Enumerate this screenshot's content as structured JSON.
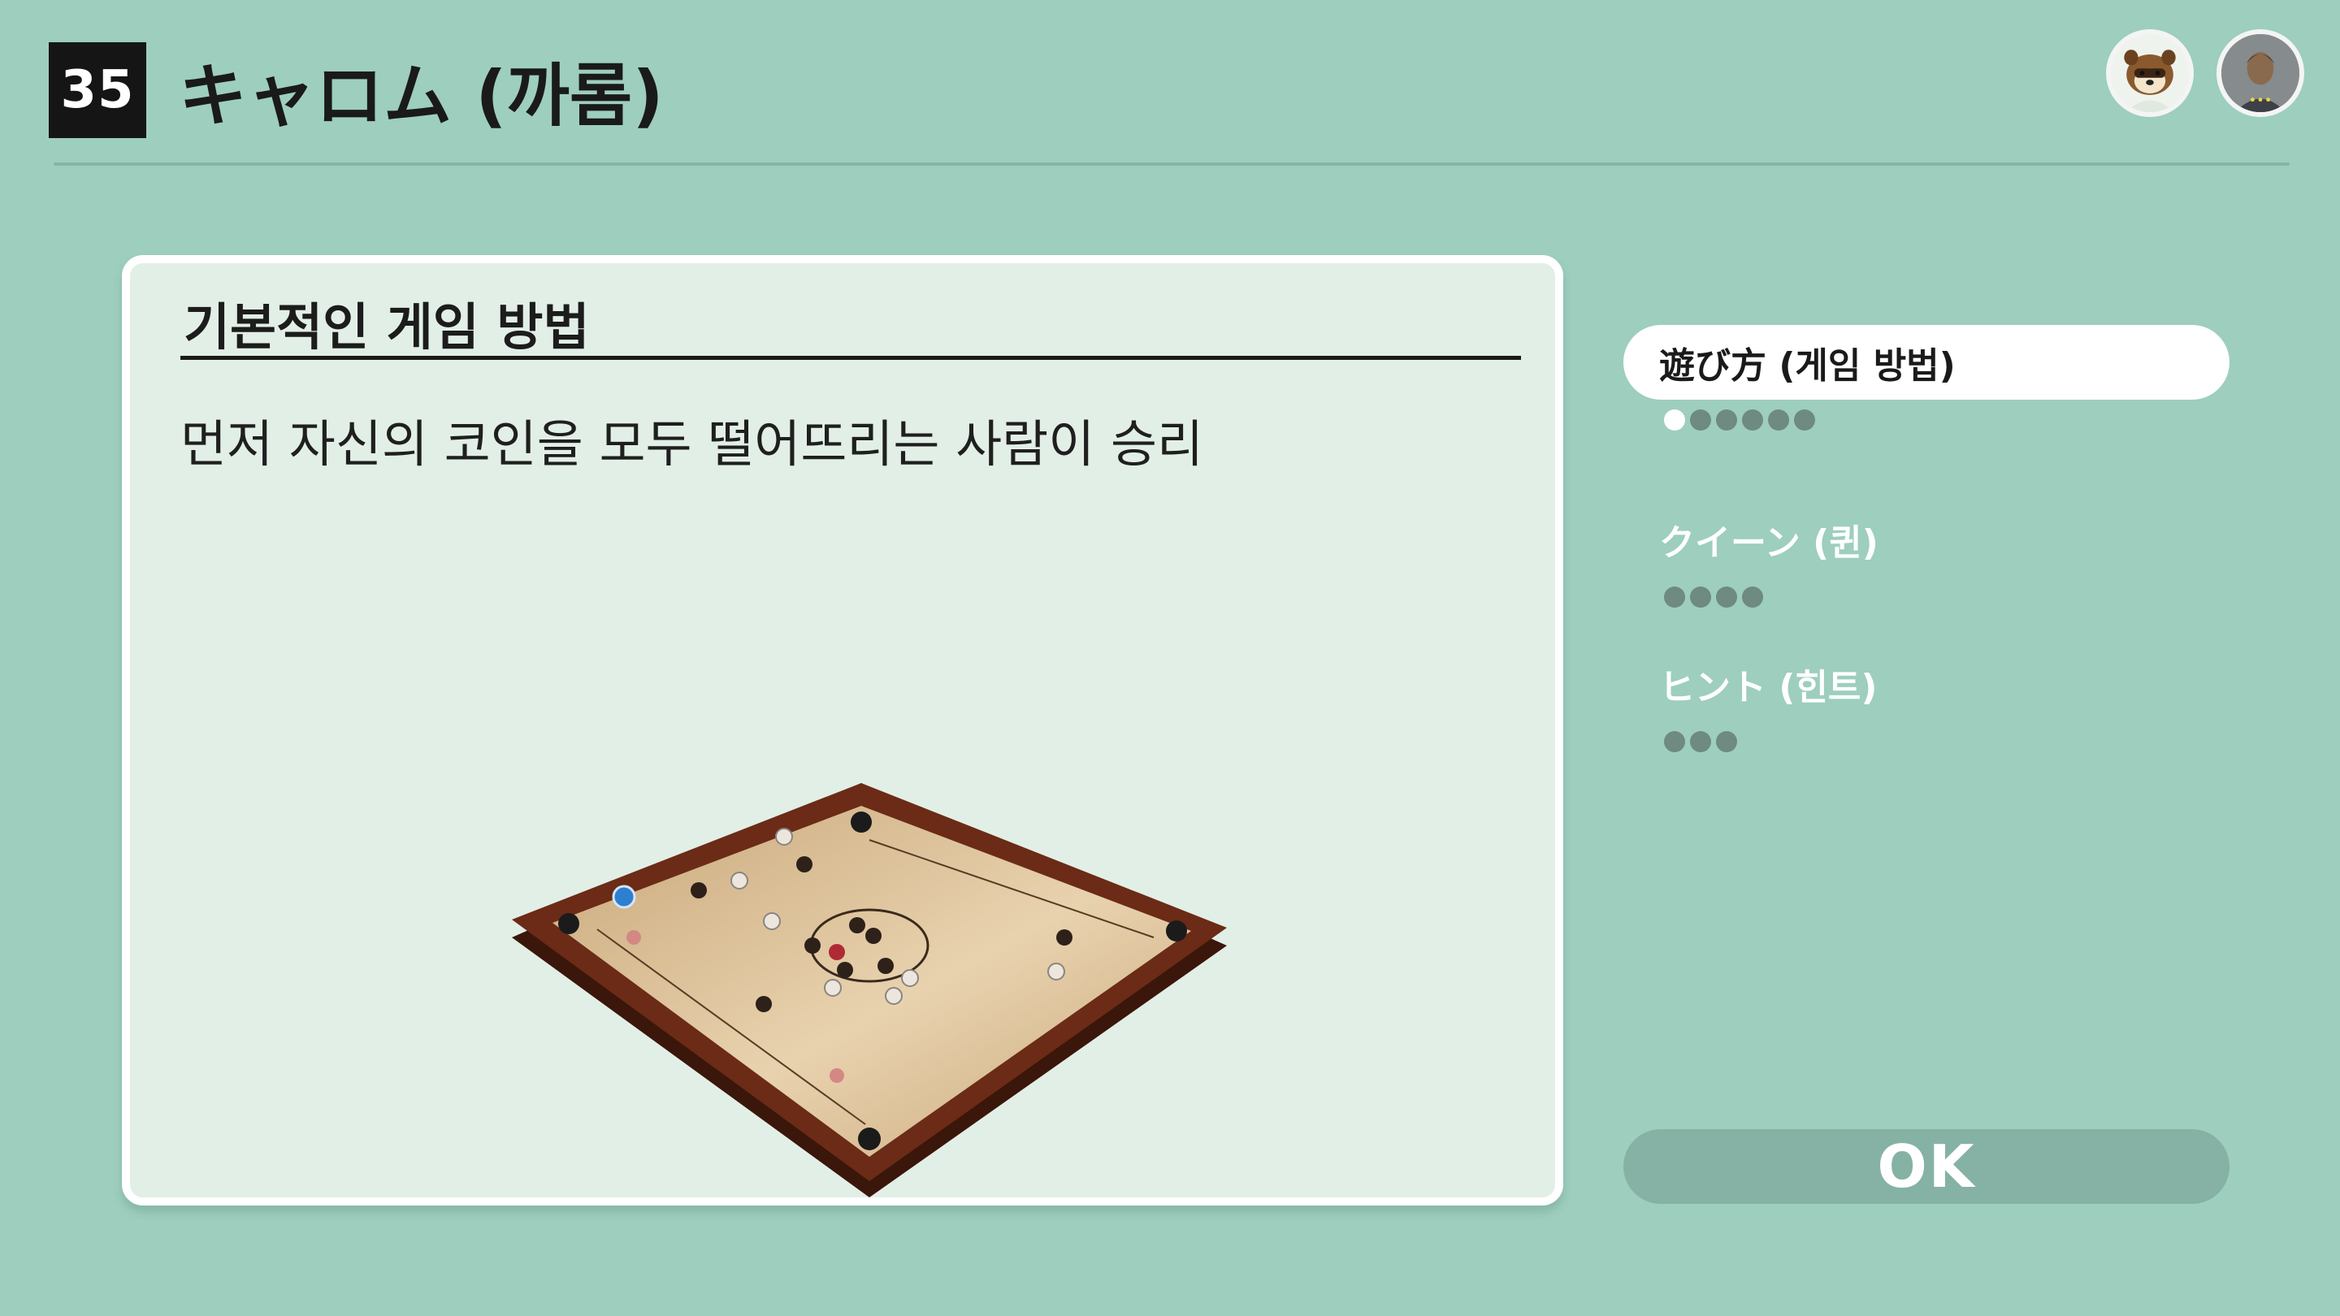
{
  "header": {
    "number": "35",
    "title": "キャロム (까롬)"
  },
  "avatars": [
    {
      "name": "villager-raccoon-avatar"
    },
    {
      "name": "player-avatar"
    }
  ],
  "card": {
    "heading": "기본적인 게임 방법",
    "body": "먼저 자신의 코인을 모두 떨어뜨리는 사람이 승리"
  },
  "menu": {
    "items": [
      {
        "label": "遊び方 (게임 방법)",
        "active": true,
        "pages": 6,
        "current_page": 1
      },
      {
        "label": "クイーン (퀸)",
        "active": false,
        "pages": 4,
        "current_page": 0
      },
      {
        "label": "ヒント (힌트)",
        "active": false,
        "pages": 3,
        "current_page": 0
      }
    ]
  },
  "ok_button": {
    "label": "OK"
  },
  "colors": {
    "background": "#9dcebe",
    "card": "#e2efe6",
    "board_frame": "#6b2b16",
    "board_surface": "#dcc09a"
  }
}
